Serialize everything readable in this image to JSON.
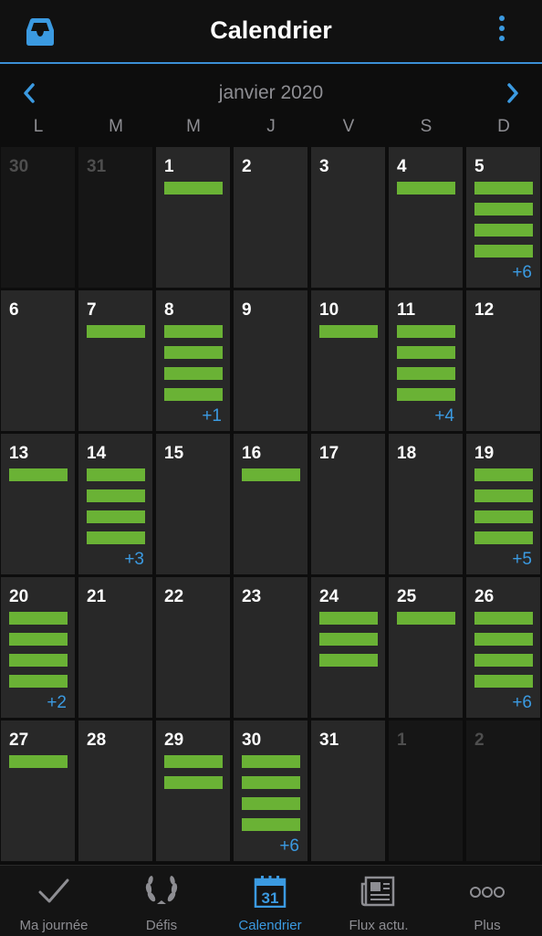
{
  "header": {
    "title": "Calendrier"
  },
  "month": {
    "label": "janvier 2020"
  },
  "weekdays": [
    "L",
    "M",
    "M",
    "J",
    "V",
    "S",
    "D"
  ],
  "colors": {
    "accent": "#3b9ae1",
    "bar": "#6ab235",
    "cell": "#282828"
  },
  "weeks": [
    [
      {
        "day": "30",
        "other": true,
        "bars": 0,
        "more": ""
      },
      {
        "day": "31",
        "other": true,
        "bars": 0,
        "more": ""
      },
      {
        "day": "1",
        "bars": 1,
        "more": ""
      },
      {
        "day": "2",
        "bars": 0,
        "more": ""
      },
      {
        "day": "3",
        "bars": 0,
        "more": ""
      },
      {
        "day": "4",
        "bars": 1,
        "more": ""
      },
      {
        "day": "5",
        "bars": 4,
        "more": "+6"
      }
    ],
    [
      {
        "day": "6",
        "bars": 0,
        "more": ""
      },
      {
        "day": "7",
        "bars": 1,
        "more": ""
      },
      {
        "day": "8",
        "bars": 4,
        "more": "+1"
      },
      {
        "day": "9",
        "bars": 0,
        "more": ""
      },
      {
        "day": "10",
        "bars": 1,
        "more": ""
      },
      {
        "day": "11",
        "bars": 4,
        "more": "+4"
      },
      {
        "day": "12",
        "bars": 0,
        "more": ""
      }
    ],
    [
      {
        "day": "13",
        "bars": 1,
        "more": ""
      },
      {
        "day": "14",
        "bars": 4,
        "more": "+3"
      },
      {
        "day": "15",
        "bars": 0,
        "more": ""
      },
      {
        "day": "16",
        "bars": 1,
        "more": ""
      },
      {
        "day": "17",
        "bars": 0,
        "more": ""
      },
      {
        "day": "18",
        "bars": 0,
        "more": ""
      },
      {
        "day": "19",
        "bars": 4,
        "more": "+5"
      }
    ],
    [
      {
        "day": "20",
        "bars": 4,
        "more": "+2"
      },
      {
        "day": "21",
        "bars": 0,
        "more": ""
      },
      {
        "day": "22",
        "bars": 0,
        "more": ""
      },
      {
        "day": "23",
        "bars": 0,
        "more": ""
      },
      {
        "day": "24",
        "bars": 3,
        "more": ""
      },
      {
        "day": "25",
        "bars": 1,
        "more": ""
      },
      {
        "day": "26",
        "bars": 4,
        "more": "+6"
      }
    ],
    [
      {
        "day": "27",
        "bars": 1,
        "more": ""
      },
      {
        "day": "28",
        "bars": 0,
        "more": ""
      },
      {
        "day": "29",
        "bars": 2,
        "more": ""
      },
      {
        "day": "30",
        "bars": 4,
        "more": "+6"
      },
      {
        "day": "31",
        "bars": 0,
        "more": ""
      },
      {
        "day": "1",
        "other": true,
        "bars": 0,
        "more": ""
      },
      {
        "day": "2",
        "other": true,
        "bars": 0,
        "more": ""
      }
    ]
  ],
  "tabs": [
    {
      "label": "Ma journée",
      "icon": "check-icon",
      "active": false
    },
    {
      "label": "Défis",
      "icon": "laurel-icon",
      "active": false
    },
    {
      "label": "Calendrier",
      "icon": "calendar-icon",
      "active": true,
      "icon_text": "31"
    },
    {
      "label": "Flux actu.",
      "icon": "newspaper-icon",
      "active": false
    },
    {
      "label": "Plus",
      "icon": "more-dots-icon",
      "active": false
    }
  ]
}
